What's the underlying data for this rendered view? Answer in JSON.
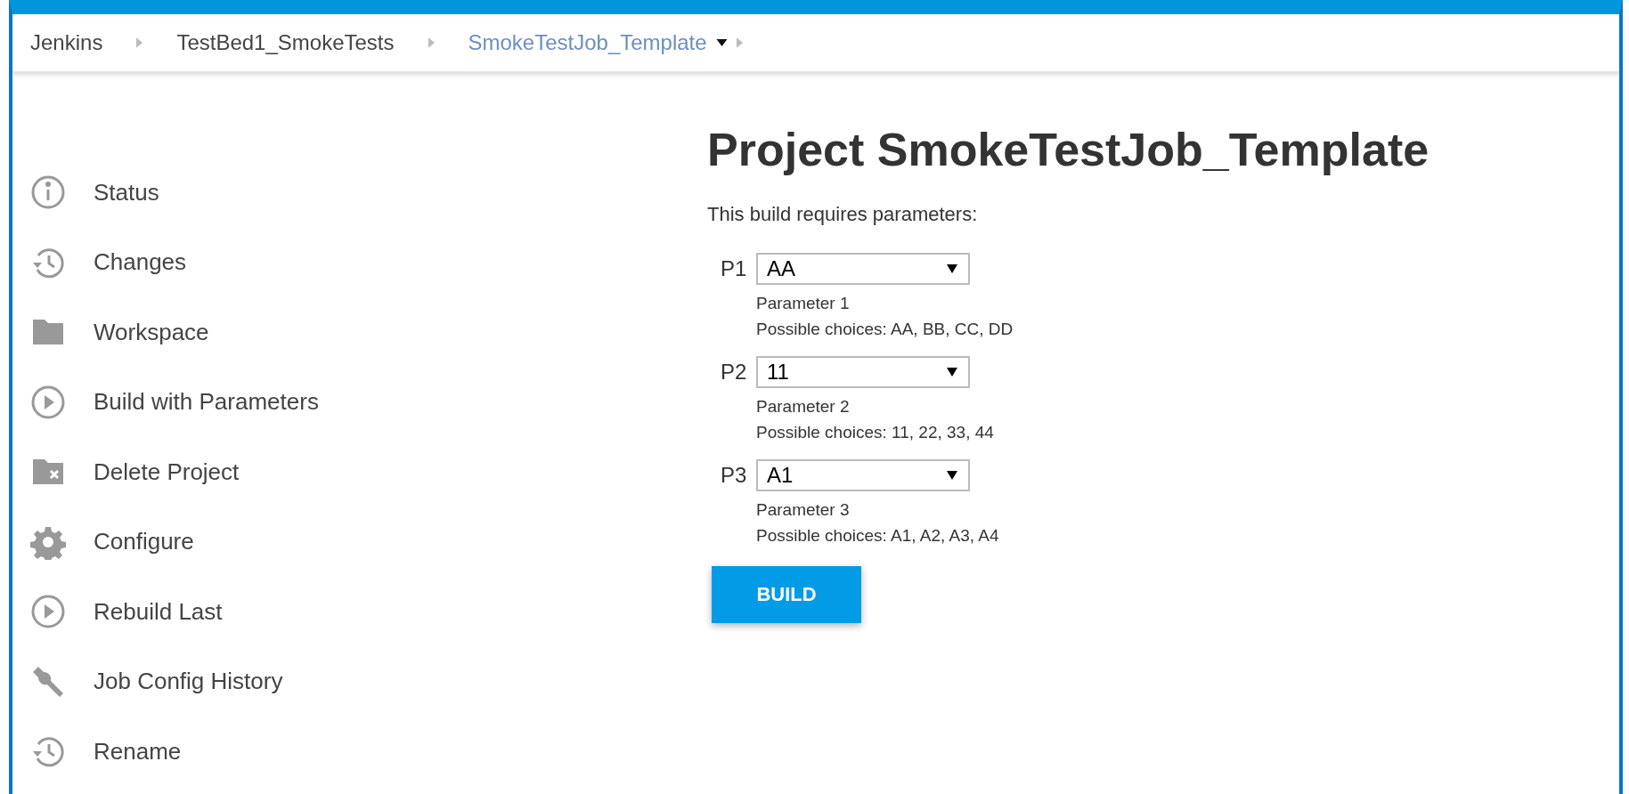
{
  "breadcrumbs": [
    {
      "label": "Jenkins",
      "selected": false
    },
    {
      "label": "TestBed1_SmokeTests",
      "selected": false
    },
    {
      "label": "SmokeTestJob_Template",
      "selected": true
    }
  ],
  "sidebar": {
    "items": [
      {
        "label": "Status",
        "kind": "info"
      },
      {
        "label": "Changes",
        "kind": "history"
      },
      {
        "label": "Workspace",
        "kind": "folder"
      },
      {
        "label": "Build with Parameters",
        "kind": "play"
      },
      {
        "label": "Delete Project",
        "kind": "folder-x"
      },
      {
        "label": "Configure",
        "kind": "gear"
      },
      {
        "label": "Rebuild Last",
        "kind": "play"
      },
      {
        "label": "Job Config History",
        "kind": "wrench"
      },
      {
        "label": "Rename",
        "kind": "history"
      }
    ]
  },
  "main": {
    "title": "Project SmokeTestJob_Template",
    "intro": "This build requires parameters:",
    "parameters": [
      {
        "name": "P1",
        "value": "AA",
        "description": "Parameter 1",
        "choices": "Possible choices: AA, BB, CC, DD"
      },
      {
        "name": "P2",
        "value": "11",
        "description": "Parameter 2",
        "choices": "Possible choices: 11, 22, 33, 44"
      },
      {
        "name": "P3",
        "value": "A1",
        "description": "Parameter 3",
        "choices": "Possible choices: A1, A2, A3, A4"
      }
    ],
    "button": "BUILD"
  }
}
